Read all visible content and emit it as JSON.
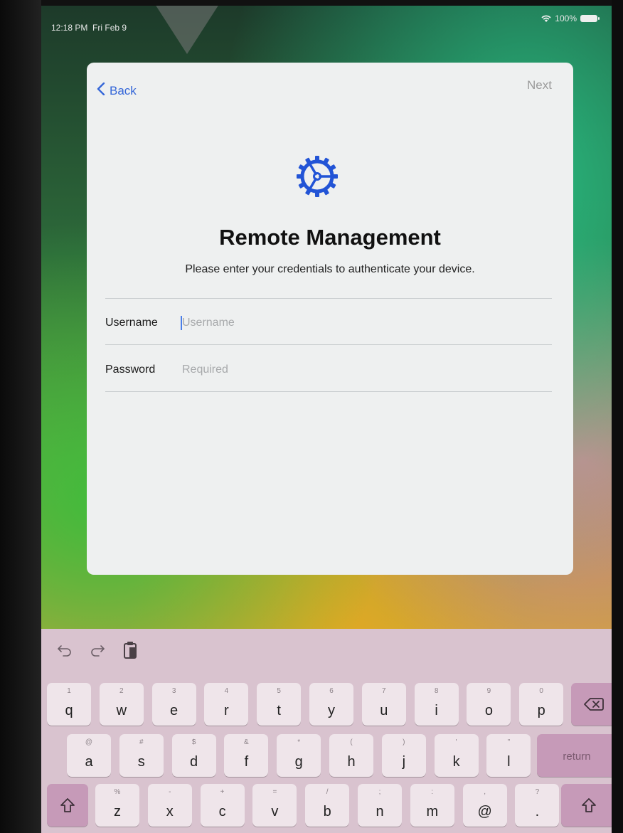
{
  "status_bar": {
    "time": "12:18 PM",
    "date": "Fri Feb 9",
    "battery": "100%",
    "wifi_icon": "wifi-icon"
  },
  "nav": {
    "back_label": "Back",
    "next_label": "Next"
  },
  "header": {
    "icon": "gear-icon",
    "title": "Remote Management",
    "subtitle": "Please enter your credentials to authenticate your device."
  },
  "form": {
    "username": {
      "label": "Username",
      "placeholder": "Username",
      "value": ""
    },
    "password": {
      "label": "Password",
      "placeholder": "Required",
      "value": ""
    }
  },
  "keyboard": {
    "toolbar": [
      "undo-icon",
      "redo-icon",
      "paste-icon"
    ],
    "rows": [
      [
        {
          "sec": "1",
          "pri": "q"
        },
        {
          "sec": "2",
          "pri": "w"
        },
        {
          "sec": "3",
          "pri": "e"
        },
        {
          "sec": "4",
          "pri": "r"
        },
        {
          "sec": "5",
          "pri": "t"
        },
        {
          "sec": "6",
          "pri": "y"
        },
        {
          "sec": "7",
          "pri": "u"
        },
        {
          "sec": "8",
          "pri": "i"
        },
        {
          "sec": "9",
          "pri": "o"
        },
        {
          "sec": "0",
          "pri": "p"
        }
      ],
      [
        {
          "sec": "@",
          "pri": "a"
        },
        {
          "sec": "#",
          "pri": "s"
        },
        {
          "sec": "$",
          "pri": "d"
        },
        {
          "sec": "&",
          "pri": "f"
        },
        {
          "sec": "*",
          "pri": "g"
        },
        {
          "sec": "(",
          "pri": "h"
        },
        {
          "sec": ")",
          "pri": "j"
        },
        {
          "sec": "'",
          "pri": "k"
        },
        {
          "sec": "\"",
          "pri": "l"
        }
      ],
      [
        {
          "sec": "%",
          "pri": "z"
        },
        {
          "sec": "-",
          "pri": "x"
        },
        {
          "sec": "+",
          "pri": "c"
        },
        {
          "sec": "=",
          "pri": "v"
        },
        {
          "sec": "/",
          "pri": "b"
        },
        {
          "sec": ";",
          "pri": "n"
        },
        {
          "sec": ":",
          "pri": "m"
        },
        {
          "sec": ",",
          "pri": "@"
        },
        {
          "sec": "?",
          "pri": "."
        }
      ]
    ],
    "return_label": "return",
    "delete_icon": "delete-icon",
    "shift_icon": "shift-icon"
  }
}
